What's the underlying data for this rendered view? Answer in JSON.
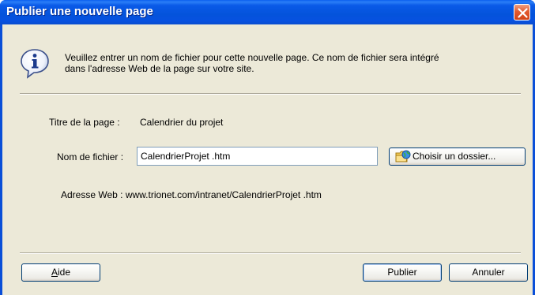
{
  "window": {
    "title": "Publier une nouvelle page"
  },
  "info": {
    "icon": "info-icon",
    "text_line1": "Veuillez entrer un nom de fichier pour cette nouvelle page. Ce nom de fichier sera intégré",
    "text_line2": "dans l'adresse Web de la page sur votre site."
  },
  "form": {
    "page_title_label": "Titre de la page :",
    "page_title_value": "Calendrier du projet",
    "file_name_label": "Nom de fichier :",
    "file_name_value": "CalendrierProjet .htm",
    "choose_folder_label": "Choisir un dossier...",
    "web_address_label": "Adresse Web :",
    "web_address_value": "www.trionet.com/intranet/CalendrierProjet .htm"
  },
  "buttons": {
    "help_first": "A",
    "help_rest": "ide",
    "publish": "Publier",
    "cancel": "Annuler"
  },
  "colors": {
    "titlebar": "#0453db",
    "close": "#e35a2f",
    "dialog_bg": "#ece9d8",
    "button_border": "#003c74"
  }
}
